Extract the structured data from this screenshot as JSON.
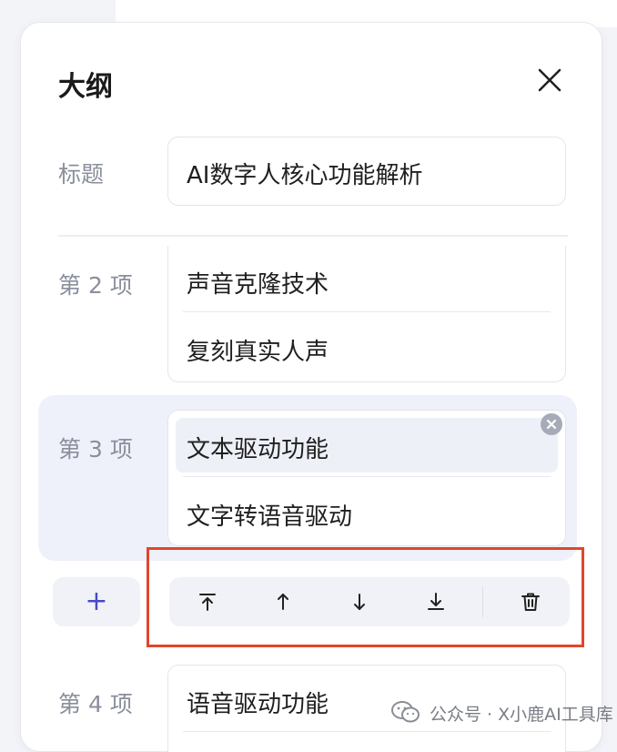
{
  "panel": {
    "title": "大纲"
  },
  "title_field": {
    "label": "标题",
    "value": "AI数字人核心功能解析"
  },
  "items": [
    {
      "label": "第 2 项",
      "heading": "声音克隆技术",
      "detail": "复刻真实人声"
    },
    {
      "label": "第 3 项",
      "heading": "文本驱动功能",
      "detail": "文字转语音驱动"
    },
    {
      "label": "第 4 项",
      "heading": "语音驱动功能"
    }
  ],
  "toolbar": {
    "add_label": "+",
    "icons": [
      "move-to-top-icon",
      "move-up-icon",
      "move-down-icon",
      "move-to-bottom-icon",
      "trash-icon"
    ]
  },
  "watermark": {
    "text": "公众号 · X小鹿AI工具库"
  },
  "colors": {
    "accent": "#4b47c8",
    "highlight_red": "#e0462c",
    "selected_bg": "#eff1fa",
    "label_gray": "#8a8f9c"
  }
}
